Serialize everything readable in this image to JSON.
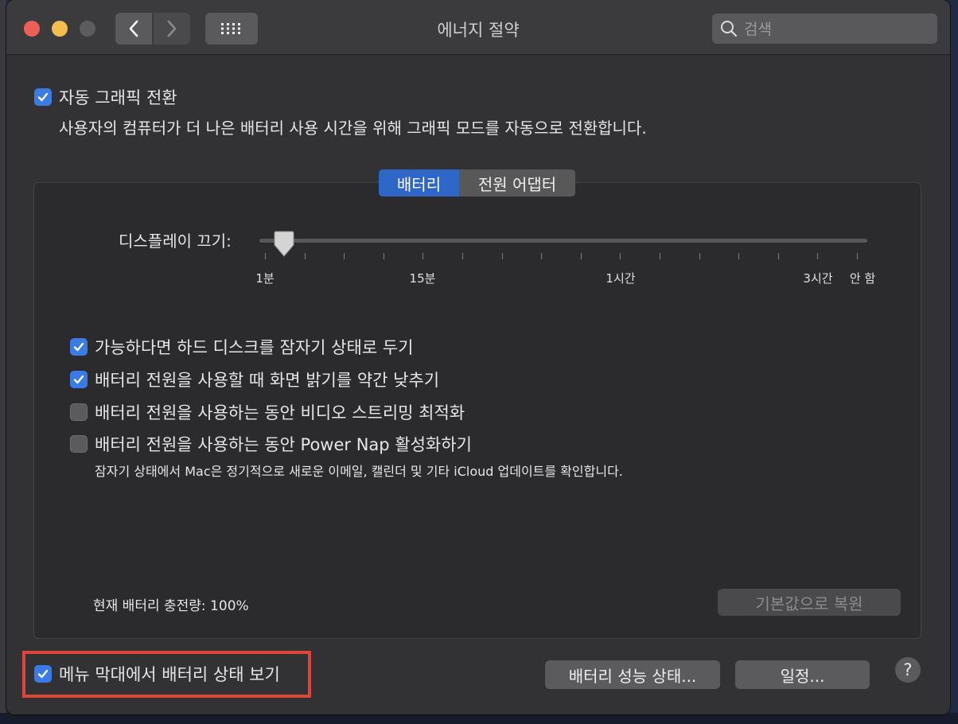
{
  "window": {
    "title": "에너지 절약",
    "search_placeholder": "검색"
  },
  "auto_graphics": {
    "checked": true,
    "label": "자동 그래픽 전환",
    "description": "사용자의 컴퓨터가 더 나은 배터리 사용 시간을 위해 그래픽 모드를 자동으로 전환합니다."
  },
  "tabs": [
    {
      "label": "배터리",
      "selected": true
    },
    {
      "label": "전원 어댑터",
      "selected": false
    }
  ],
  "display_off": {
    "label": "디스플레이 끄기:",
    "value": "1분",
    "tick_labels": [
      "1분",
      "15분",
      "1시간",
      "3시간",
      "안 함"
    ]
  },
  "options": [
    {
      "label": "가능하다면 하드 디스크를 잠자기 상태로 두기",
      "checked": true
    },
    {
      "label": "배터리 전원을 사용할 때 화면 밝기를 약간 낮추기",
      "checked": true
    },
    {
      "label": "배터리 전원을 사용하는 동안 비디오 스트리밍 최적화",
      "checked": false
    },
    {
      "label": "배터리 전원을 사용하는 동안 Power Nap 활성화하기",
      "checked": false
    }
  ],
  "power_nap_description": "잠자기 상태에서 Mac은 정기적으로 새로운 이메일, 캘린더 및 기타 iCloud 업데이트를 확인합니다.",
  "battery_level": "현재 배터리 충전량: 100%",
  "restore_defaults": "기본값으로 복원",
  "menu_bar": {
    "label": "메뉴 막대에서 배터리 상태 보기",
    "checked": true
  },
  "buttons": {
    "battery_health": "배터리 성능 상태...",
    "schedule": "일정...",
    "help": "?"
  },
  "colors": {
    "accent": "#3b7be6",
    "highlight_box": "#e0453a"
  }
}
